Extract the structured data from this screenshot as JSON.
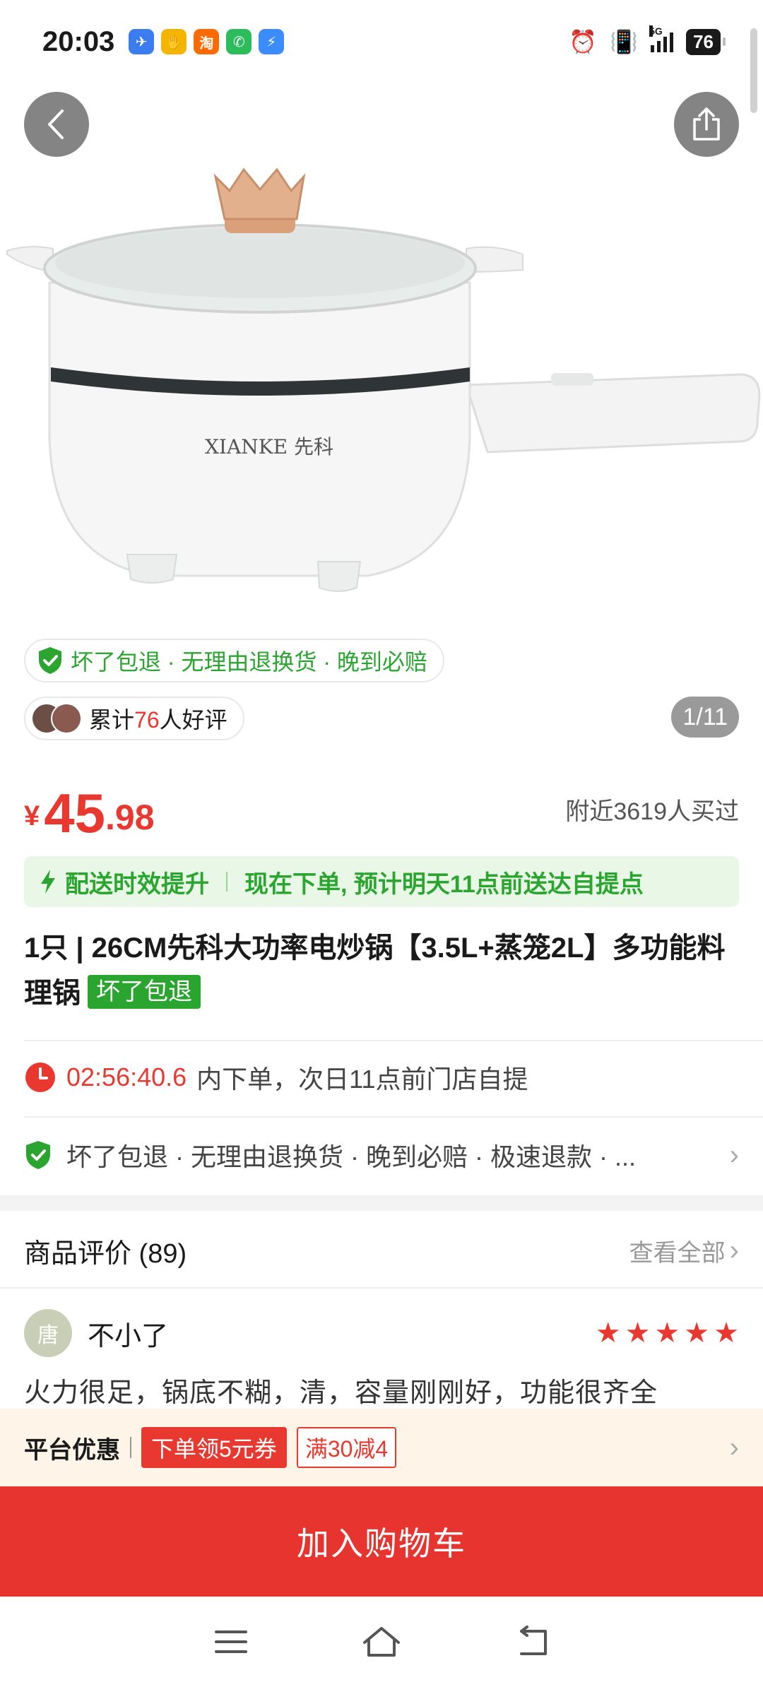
{
  "status_bar": {
    "time": "20:03",
    "network": "5G",
    "battery": "76",
    "apps": [
      {
        "name": "browser-app-icon",
        "color": "#3b7df0",
        "glyph": "✈"
      },
      {
        "name": "wallet-app-icon",
        "color": "#f5b400",
        "glyph": "✋"
      },
      {
        "name": "taobao-app-icon",
        "color": "#ff6a00",
        "glyph": "淘"
      },
      {
        "name": "phone-app-icon",
        "color": "#2cbc5b",
        "glyph": "✆"
      },
      {
        "name": "flash-app-icon",
        "color": "#3a8cff",
        "glyph": "⚡"
      }
    ]
  },
  "hero": {
    "page_indicator": "1/11",
    "brand_on_product": "XIANKE 先科"
  },
  "guarantee_pill": "坏了包退 · 无理由退换货 · 晚到必赔",
  "rating_pill": {
    "prefix": "累计",
    "count": "76",
    "suffix": "人好评"
  },
  "price": {
    "symbol": "¥",
    "integer": "45",
    "decimal": ".98",
    "sold_text": "附近3619人买过"
  },
  "delivery": {
    "label": "配送时效提升",
    "message": "现在下单, 预计明天11点前送达自提点"
  },
  "product": {
    "title": "1只 | 26CM先科大功率电炒锅【3.5L+蒸笼2L】多功能料理锅",
    "badge": "坏了包退"
  },
  "pickup": {
    "timer": "02:56:40.6",
    "message": "内下单，次日11点前门店自提"
  },
  "service": {
    "message": "坏了包退 · 无理由退换货 · 晚到必赔 · 极速退款 · ..."
  },
  "reviews": {
    "heading": "商品评价 (89)",
    "view_all": "查看全部",
    "items": [
      {
        "avatar_char": "唐",
        "user": "不小了",
        "stars": 5,
        "text": "火力很足，锅底不糊，清，容量刚刚好，功能很齐全"
      }
    ]
  },
  "promo": {
    "label": "平台优惠",
    "coupon_1": "下单领5元券",
    "coupon_2": "满30减4"
  },
  "cart_button": "加入购物车",
  "colors": {
    "accent_red": "#e8382f",
    "accent_green": "#2aa52f"
  }
}
